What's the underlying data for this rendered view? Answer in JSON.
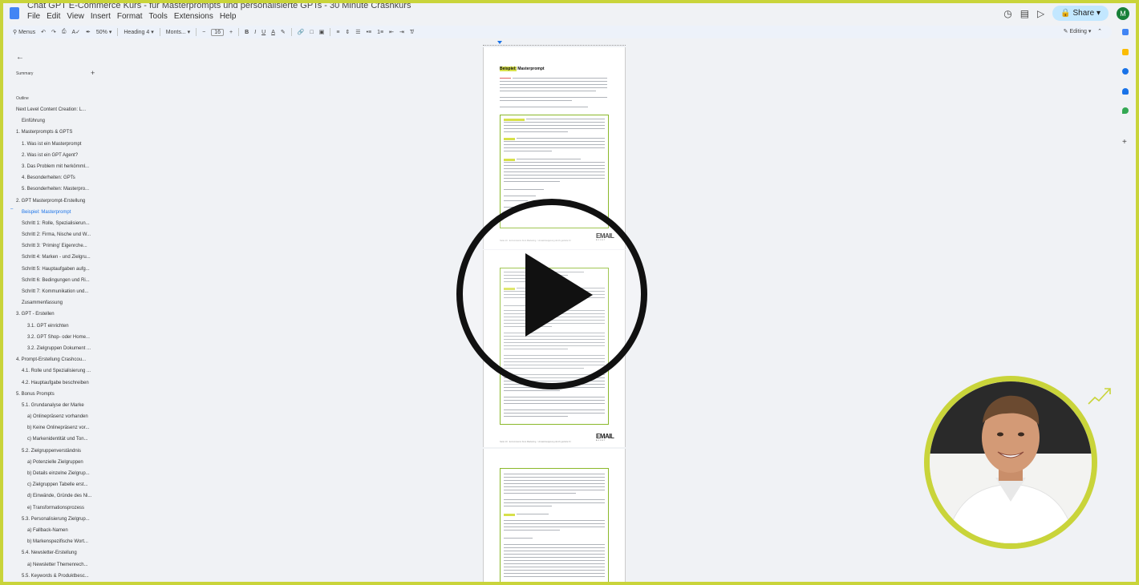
{
  "titlebar": {
    "doc_title": "Chat GPT E-Commerce Kurs - für Masterprompts und personalisierte GPTs - 30 Minute Crashkurs",
    "menu": [
      "File",
      "Edit",
      "View",
      "Insert",
      "Format",
      "Tools",
      "Extensions",
      "Help"
    ],
    "share_label": "Share",
    "avatar_letter": "M"
  },
  "toolbar": {
    "menus_label": "Menus",
    "zoom": "50%",
    "style": "Heading 4",
    "font": "Monts...",
    "font_size": "16",
    "bold": "B",
    "italic": "I",
    "underline": "U",
    "text_color": "A",
    "editing_label": "Editing"
  },
  "outline": {
    "summary_label": "Summary",
    "outline_label": "Outline",
    "items": [
      {
        "label": "Next Level Content Creation: L...",
        "level": 0
      },
      {
        "label": "Einführung",
        "level": 1
      },
      {
        "label": "1. Masterprompts & GPTS",
        "level": 0
      },
      {
        "label": "1. Was ist ein Masterprompt",
        "level": 1
      },
      {
        "label": "2. Was ist ein GPT Agent?",
        "level": 1
      },
      {
        "label": "3. Das Problem mit herkömml...",
        "level": 1
      },
      {
        "label": "4. Besonderheiten: GPTs",
        "level": 1
      },
      {
        "label": "5. Besonderheiten: Masterpro...",
        "level": 1
      },
      {
        "label": "2. GPT Masterprompt-Erstellung",
        "level": 0
      },
      {
        "label": "Beispiel: Masterprompt",
        "level": 1,
        "active": true
      },
      {
        "label": "Schritt 1: Rolle, Spezialisierun...",
        "level": 1
      },
      {
        "label": "Schritt 2: Firma, Nische und W...",
        "level": 1
      },
      {
        "label": "Schritt 3: 'Priming' Eigenrche...",
        "level": 1
      },
      {
        "label": "Schritt 4: Marken - und Zielgru...",
        "level": 1
      },
      {
        "label": "Schritt 5: Hauptaufgaben aufg...",
        "level": 1
      },
      {
        "label": "Schritt 6: Bedingungen und Ri...",
        "level": 1
      },
      {
        "label": "Schritt 7: Kommunikation und...",
        "level": 1
      },
      {
        "label": "Zusammenfassung",
        "level": 1
      },
      {
        "label": "3. GPT - Erstellen",
        "level": 0
      },
      {
        "label": "3.1. GPT einrichten",
        "level": 2
      },
      {
        "label": "3.2. GPT Shop- oder Home...",
        "level": 2
      },
      {
        "label": "3.2. Zielgruppen Dokument ...",
        "level": 2
      },
      {
        "label": "4. Prompt-Erstellung Crashcou...",
        "level": 0
      },
      {
        "label": "4.1. Rolle und Spezialisierung ...",
        "level": 1
      },
      {
        "label": "4.2. Hauptaufgabe beschreiben",
        "level": 1
      },
      {
        "label": "5. Bonus Prompts",
        "level": 0
      },
      {
        "label": "5.1. Grundanalyse der Marke",
        "level": 1
      },
      {
        "label": "a) Onlinepräsenz vorhanden",
        "level": 2
      },
      {
        "label": "b) Keine Onlinepräsenz vor...",
        "level": 2
      },
      {
        "label": "c) Markenidentität und Ton...",
        "level": 2
      },
      {
        "label": "5.2. Zielgruppenverständnis",
        "level": 1
      },
      {
        "label": "a) Potenzielle Zielgruppen",
        "level": 2
      },
      {
        "label": "b) Details einzelne Zielgrup...",
        "level": 2
      },
      {
        "label": "c) Zielgruppen Tabelle erst...",
        "level": 2
      },
      {
        "label": "d) Einwände, Gründe des Ni...",
        "level": 2
      },
      {
        "label": "e) Transformationsprozess",
        "level": 2
      },
      {
        "label": "5.3. Personalisierung Zielgrup...",
        "level": 1
      },
      {
        "label": "a) Fallback-Namen",
        "level": 2
      },
      {
        "label": "b) Markenspezifische Wort...",
        "level": 2
      },
      {
        "label": "5.4. Newsletter-Erstellung",
        "level": 1
      },
      {
        "label": "a) Newsletter Themenrech...",
        "level": 2
      },
      {
        "label": "5.5. Keywords & Produktbesc...",
        "level": 1
      }
    ]
  },
  "document": {
    "page1_heading_prefix": "Beispiel:",
    "page1_heading_suffix": " Masterprompt",
    "footer_text": "Seite 10  ·  E-Commerce Kurs Marketing · Umsatzsteigerung durch gezielte KI",
    "logo_text": "EMAIL",
    "logo_sub": "BOOST"
  },
  "colors": {
    "frame_border": "#c9d43a",
    "accent": "#1a73e8",
    "share_bg": "#c2e7ff"
  },
  "icons": {
    "play": "play-icon",
    "back": "back-arrow-icon"
  }
}
